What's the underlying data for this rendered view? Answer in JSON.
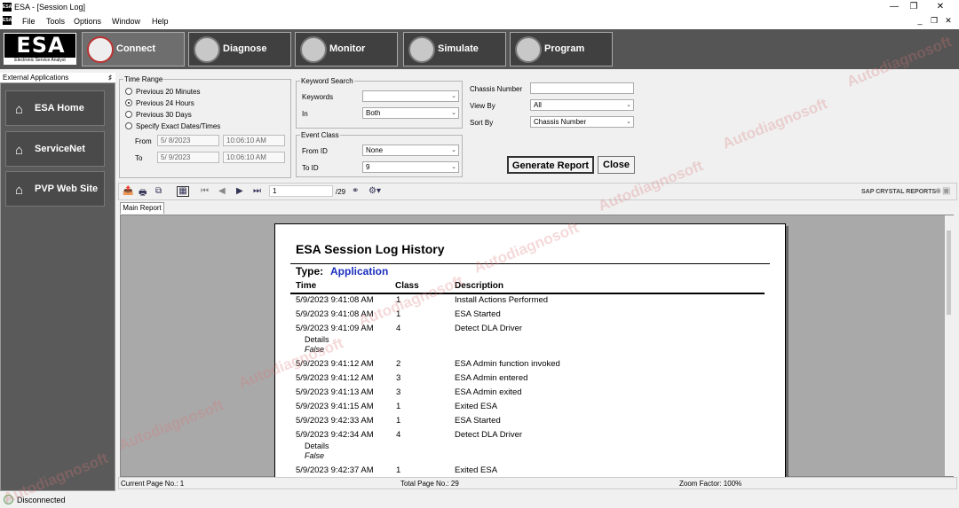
{
  "window": {
    "title": "ESA - [Session Log]",
    "app_icon": "ESA"
  },
  "menu": [
    "File",
    "Tools",
    "Options",
    "Window",
    "Help"
  ],
  "logo": {
    "text": "ESA",
    "subtitle": "Electronic Service Analyst"
  },
  "nav": [
    {
      "label": "Connect",
      "icon": "plug-icon"
    },
    {
      "label": "Diagnose",
      "icon": "stethoscope-icon"
    },
    {
      "label": "Monitor",
      "icon": "gauge-icon"
    },
    {
      "label": "Simulate",
      "icon": "simulate-icon"
    },
    {
      "label": "Program",
      "icon": "program-icon"
    }
  ],
  "external": {
    "header": "External Applications",
    "items": [
      "ESA Home",
      "ServiceNet",
      "PVP Web Site"
    ]
  },
  "time_range": {
    "legend": "Time Range",
    "options": [
      "Previous 20 Minutes",
      "Previous 24 Hours",
      "Previous 30 Days",
      "Specify Exact Dates/Times"
    ],
    "selected": 1,
    "from_label": "From",
    "from_date": "5/ 8/2023",
    "from_time": "10:06:10 AM",
    "to_label": "To",
    "to_date": "5/ 9/2023",
    "to_time": "10:06:10 AM"
  },
  "keyword_search": {
    "legend": "Keyword Search",
    "keywords_label": "Keywords",
    "keywords_value": "",
    "in_label": "In",
    "in_value": "Both"
  },
  "event_class": {
    "legend": "Event Class",
    "from_label": "From ID",
    "from_value": "None",
    "to_label": "To ID",
    "to_value": "9"
  },
  "right_filters": {
    "chassis_label": "Chassis Number",
    "chassis_value": "",
    "viewby_label": "View By",
    "viewby_value": "All",
    "sortby_label": "Sort By",
    "sortby_value": "Chassis Number"
  },
  "buttons": {
    "generate": "Generate Report",
    "close": "Close"
  },
  "report_toolbar": {
    "page_input": "1",
    "page_total": "/29",
    "brand": "SAP CRYSTAL REPORTS®"
  },
  "tab": "Main Report",
  "report": {
    "title": "ESA Session Log History",
    "type_label": "Type:",
    "type_value": "Application",
    "col_time": "Time",
    "col_class": "Class",
    "col_desc": "Description",
    "rows": [
      {
        "time": "5/9/2023 9:41:08 AM",
        "cls": "1",
        "desc": "Install Actions Performed"
      },
      {
        "time": "5/9/2023 9:41:08 AM",
        "cls": "1",
        "desc": "ESA Started"
      },
      {
        "time": "5/9/2023 9:41:09 AM",
        "cls": "4",
        "desc": "Detect DLA Driver",
        "details_label": "Details",
        "details_value": "False"
      },
      {
        "time": "5/9/2023 9:41:12 AM",
        "cls": "2",
        "desc": "ESA Admin function invoked"
      },
      {
        "time": "5/9/2023 9:41:12 AM",
        "cls": "3",
        "desc": "ESA Admin entered"
      },
      {
        "time": "5/9/2023 9:41:13 AM",
        "cls": "3",
        "desc": "ESA Admin exited"
      },
      {
        "time": "5/9/2023 9:41:15 AM",
        "cls": "1",
        "desc": "Exited ESA"
      },
      {
        "time": "5/9/2023 9:42:33 AM",
        "cls": "1",
        "desc": "ESA Started"
      },
      {
        "time": "5/9/2023 9:42:34 AM",
        "cls": "4",
        "desc": "Detect DLA Driver",
        "details_label": "Details",
        "details_value": "False"
      },
      {
        "time": "5/9/2023 9:42:37 AM",
        "cls": "1",
        "desc": "Exited ESA"
      }
    ]
  },
  "status": {
    "current_page": "Current Page No.: 1",
    "total_page": "Total Page No.: 29",
    "zoom": "Zoom Factor: 100%"
  },
  "connection": "Disconnected",
  "watermark": "Autodiagnosoft"
}
